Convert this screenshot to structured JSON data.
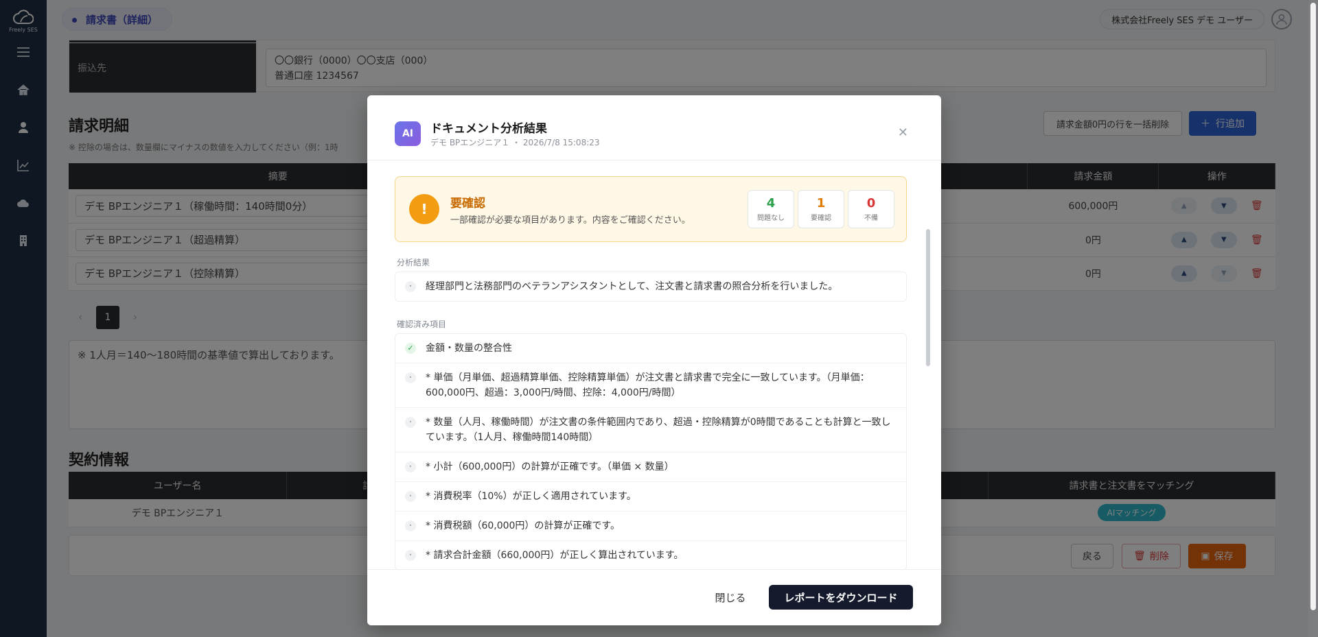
{
  "app": {
    "logo_text": "Freely SES"
  },
  "header": {
    "breadcrumb": "請求書（詳細）",
    "user_name": "株式会社Freely SES デモ ユーザー"
  },
  "bank": {
    "label": "振込先",
    "value": "〇〇銀行（0000）〇〇支店（000）\n普通口座 1234567"
  },
  "details": {
    "title": "請求明細",
    "note": "※ 控除の場合は、数量欄にマイナスの数値を入力してください（例：1時",
    "bulk_delete_label": "請求金額0円の行を一括削除",
    "add_row_label": "行追加",
    "columns": [
      "摘要",
      "請求金額",
      "操作"
    ],
    "rows": [
      {
        "summary": "デモ BPエンジニア１（稼働時間：140時間0分）",
        "amount": "600,000円"
      },
      {
        "summary": "デモ BPエンジニア１（超過精算）",
        "amount": "0円"
      },
      {
        "summary": "デモ BPエンジニア１（控除精算）",
        "amount": "0円"
      }
    ],
    "page": "1",
    "memo": "※ 1人月＝140〜180時間の基準値で算出しております。"
  },
  "contract": {
    "title": "契約情報",
    "col_user": "ユーザー名",
    "col_hidden": "請",
    "col_match": "請求書と注文書をマッチング",
    "user": "デモ BPエンジニア１",
    "ai_match_label": "AIマッチング"
  },
  "footer": {
    "back_label": "戻る",
    "delete_label": "削除",
    "save_label": "保存"
  },
  "modal": {
    "badge": "AI",
    "title": "ドキュメント分析結果",
    "subtitle": "デモ BPエンジニア１ ・ 2026/7/8 15:08:23",
    "alert": {
      "title": "要確認",
      "description": "一部確認が必要な項目があります。内容をご確認ください。",
      "stats": [
        {
          "value": "4",
          "label": "問題なし",
          "color": "#2aa04a"
        },
        {
          "value": "1",
          "label": "要確認",
          "color": "#e07b00"
        },
        {
          "value": "0",
          "label": "不備",
          "color": "#d93636"
        }
      ]
    },
    "analysis_label": "分析結果",
    "analysis_items": [
      "経理部門と法務部門のベテランアシスタントとして、注文書と請求書の照合分析を行いました。"
    ],
    "checked_label": "確認済み項目",
    "checked_items": [
      "金額・数量の整合性",
      "* 単価（月単価、超過精算単価、控除精算単価）が注文書と請求書で完全に一致しています。（月単価：600,000円、超過：3,000円/時間、控除：4,000円/時間）",
      "* 数量（人月、稼働時間）が注文書の条件範囲内であり、超過・控除精算が0時間であることも計算と一致しています。（1人月、稼働時間140時間）",
      "* 小計（600,000円）の計算が正確です。（単価 × 数量）",
      "* 消費税率（10%）が正しく適用されています。",
      "* 消費税額（60,000円）の計算が正確です。",
      "* 請求合計金額（660,000円）が正しく算出されています。"
    ],
    "close_label": "閉じる",
    "download_label": "レポートをダウンロード"
  }
}
